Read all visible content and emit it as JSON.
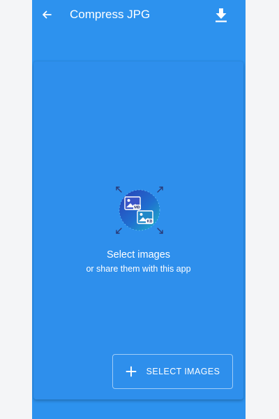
{
  "toolbar": {
    "title": "Compress JPG",
    "back_icon": "arrow-back-icon",
    "download_icon": "download-icon"
  },
  "empty_state": {
    "title": "Select images",
    "subtitle": "or share them with this app",
    "illustration_icon": "compress-images-illustration",
    "badge_top": "MB",
    "badge_bottom": "KB"
  },
  "actions": {
    "select_images_label": "SELECT IMAGES",
    "select_images_icon": "plus-icon"
  },
  "colors": {
    "background": "#2d92ee",
    "card": "#2e8fec",
    "text": "#ffffff"
  }
}
